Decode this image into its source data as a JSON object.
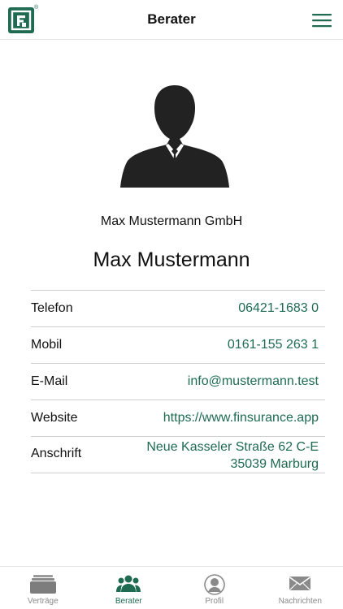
{
  "header": {
    "title": "Berater",
    "logo_mark": "®",
    "menu_icon": "hamburger-menu-icon"
  },
  "profile": {
    "company": "Max Mustermann GmbH",
    "name": "Max Mustermann",
    "avatar_icon": "person-silhouette-icon"
  },
  "contact": {
    "rows": [
      {
        "label": "Telefon",
        "value": "06421-1683 0"
      },
      {
        "label": "Mobil",
        "value": "0161-155 263 1"
      },
      {
        "label": "E-Mail",
        "value": "info@mustermann.test"
      },
      {
        "label": "Website",
        "value": "https://www.finsurance.app"
      },
      {
        "label": "Anschrift",
        "value_line1": "Neue Kasseler Straße 62 C-E",
        "value_line2": "35039 Marburg"
      }
    ]
  },
  "tabs": [
    {
      "label": "Verträge",
      "icon": "contracts-stack-icon",
      "active": false
    },
    {
      "label": "Berater",
      "icon": "people-group-icon",
      "active": true
    },
    {
      "label": "Profil",
      "icon": "profile-circle-icon",
      "active": false
    },
    {
      "label": "Nachrichten",
      "icon": "envelope-icon",
      "active": false
    }
  ],
  "colors": {
    "brand": "#1e6b52",
    "inactive": "#8a8a8a"
  }
}
